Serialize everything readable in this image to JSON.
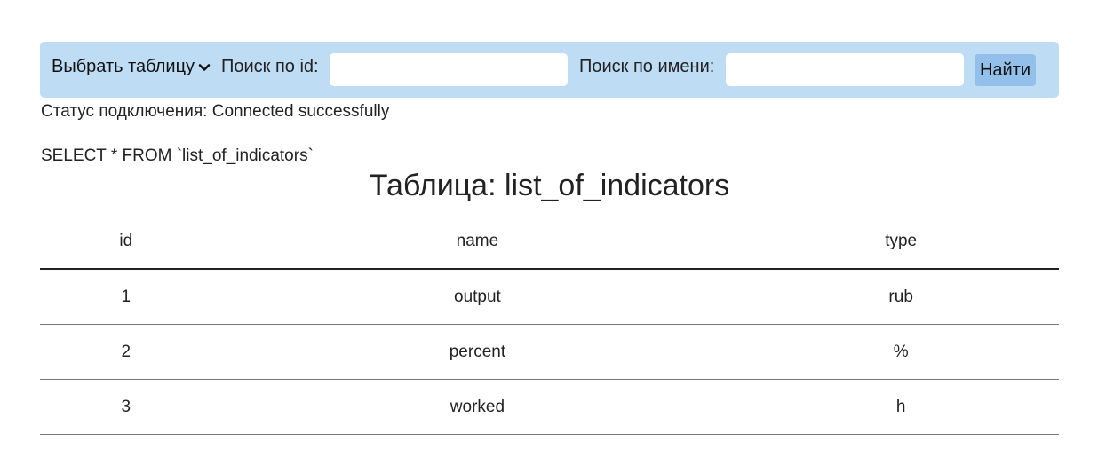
{
  "toolbar": {
    "select_label": "Выбрать таблицу",
    "search_id_label": "Поиск по id:",
    "search_id_value": "",
    "search_name_label": "Поиск по имени:",
    "search_name_value": "",
    "find_button": "Найти"
  },
  "status": "Статус подключения: Connected successfully",
  "query": "SELECT * FROM `list_of_indicators`",
  "table": {
    "title": "Таблица: list_of_indicators",
    "columns": [
      "id",
      "name",
      "type"
    ],
    "rows": [
      [
        "1",
        "output",
        "rub"
      ],
      [
        "2",
        "percent",
        "%"
      ],
      [
        "3",
        "worked",
        "h"
      ]
    ]
  },
  "colors": {
    "toolbar_bg": "#bfdcf5",
    "button_bg": "#92c0ea"
  }
}
